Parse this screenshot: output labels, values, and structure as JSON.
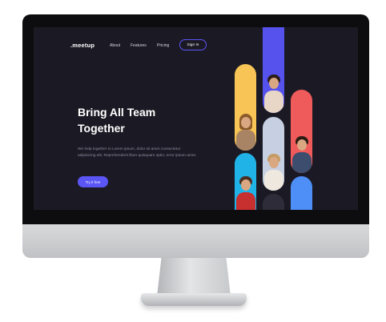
{
  "site": {
    "logo": ".meetup",
    "nav": [
      "About",
      "Features",
      "Pricing"
    ],
    "sign_in": "Sign In"
  },
  "hero": {
    "title_line1": "Bring All Team",
    "title_line2": "Together",
    "description": "We help together to Lorem ipsum, dolor sit amet consectetur adipisicing elit. Reprehenderit illum quisquam optio, error ipsum amet.",
    "cta": "Try it free"
  },
  "colors": {
    "background": "#1b1a24",
    "accent": "#5a55f4",
    "pill_purple": "#5552ee",
    "pill_yellow": "#f8c455",
    "pill_red": "#ef5a5a",
    "pill_light": "#c7cfe2",
    "pill_cyan": "#20b3e8",
    "pill_blue": "#4d8ef7"
  },
  "photos": [
    {
      "label": "woman-with-flowers"
    },
    {
      "label": "woman-smiling"
    },
    {
      "label": "man-smiling"
    },
    {
      "label": "woman-praying-hands"
    },
    {
      "label": "man-thumbs-up"
    }
  ]
}
